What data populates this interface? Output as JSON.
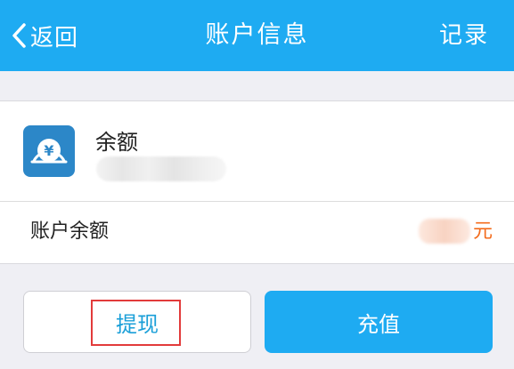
{
  "header": {
    "back_label": "返回",
    "title": "账户信息",
    "records_label": "记录"
  },
  "balance": {
    "title": "余额",
    "icon": "yen-coin-icon",
    "account_label": "账户余额",
    "currency": "元"
  },
  "actions": {
    "withdraw_label": "提现",
    "recharge_label": "充值"
  },
  "colors": {
    "accent": "#1eabf2",
    "icon_bg": "#2c87c8",
    "amount": "#f36b1c",
    "highlight": "#e23b3b"
  }
}
